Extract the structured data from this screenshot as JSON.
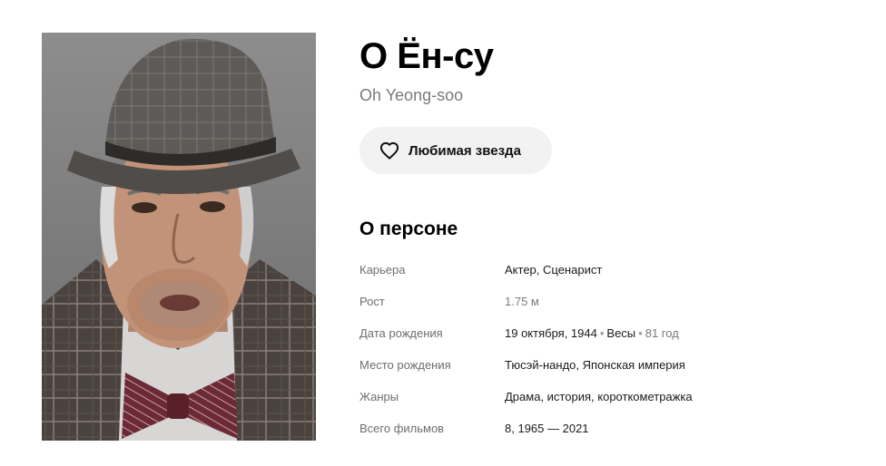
{
  "person": {
    "name": "О Ён-су",
    "original_name": "Oh Yeong-soo"
  },
  "favorite_button": {
    "label": "Любимая звезда",
    "icon": "heart-outline-icon"
  },
  "about": {
    "title": "О персоне",
    "career": {
      "label": "Карьера",
      "values": [
        "Актер",
        "Сценарист"
      ]
    },
    "height": {
      "label": "Рост",
      "value": "1.75 м"
    },
    "birth_date": {
      "label": "Дата рождения",
      "date": "19 октября, 1944",
      "sign": "Весы",
      "age": "81 год"
    },
    "birth_place": {
      "label": "Место рождения",
      "values": [
        "Тюсэй-нандо",
        "Японская империя"
      ]
    },
    "genres": {
      "label": "Жанры",
      "values": [
        "Драма",
        "история",
        "короткометражка"
      ]
    },
    "films": {
      "label": "Всего фильмов",
      "count": "8",
      "years": "1965 — 2021"
    }
  },
  "photo": {
    "alt": "portrait"
  },
  "colors": {
    "button_bg": "#f2f2f2",
    "muted_text": "#6e6e6e",
    "bow_tie": "#6b2a35"
  }
}
